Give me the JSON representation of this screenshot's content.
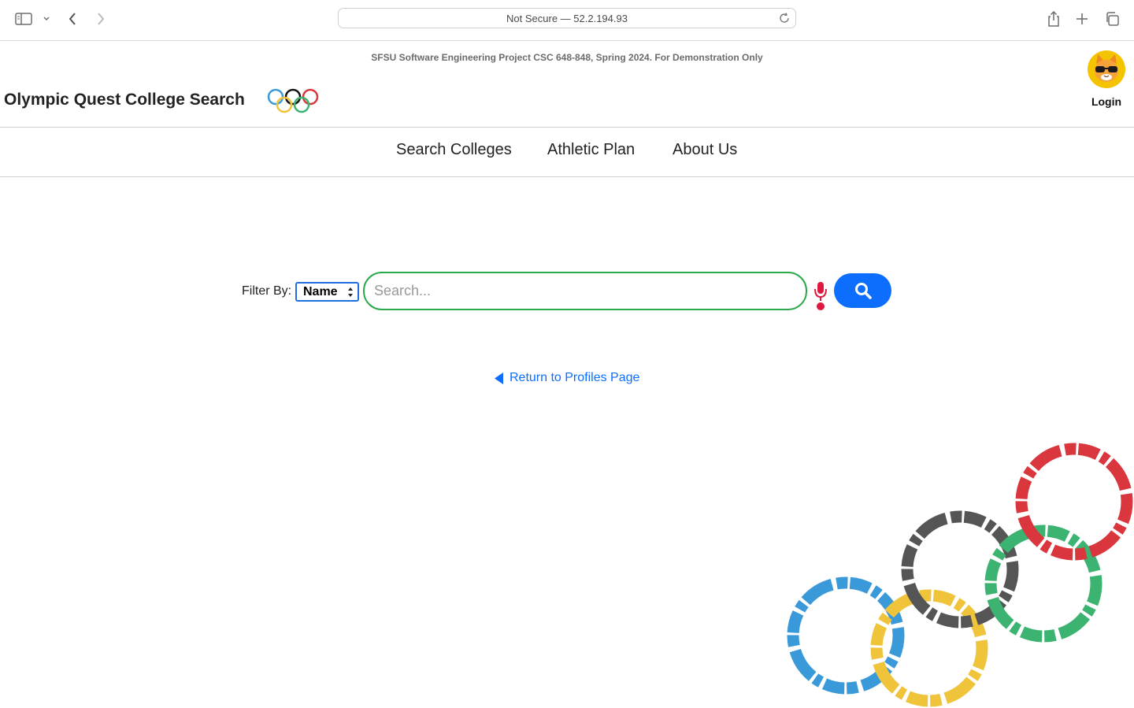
{
  "browser": {
    "url": "Not Secure — 52.2.194.93",
    "icons": [
      "sidebar-icon",
      "chevron-down-icon",
      "back-icon",
      "forward-icon",
      "reload-icon",
      "share-icon",
      "new-tab-icon",
      "tabs-overview-icon"
    ]
  },
  "header": {
    "disclaimer": "SFSU Software Engineering Project CSC 648-848, Spring 2024. For Demonstration Only",
    "title": "Olympic Quest College Search",
    "login_label": "Login"
  },
  "nav": {
    "items": [
      {
        "label": "Search Colleges"
      },
      {
        "label": "Athletic Plan"
      },
      {
        "label": "About Us"
      }
    ]
  },
  "search": {
    "filter_label": "Filter By:",
    "filter_value": "Name",
    "placeholder": "Search...",
    "value": ""
  },
  "return_link": "Return to Profiles Page",
  "colors": {
    "accent": "#0d6efd",
    "input_border": "#2ba84a",
    "mic": "#e0173e",
    "ring_blue": "#3a9ad9",
    "ring_yellow": "#f0c43a",
    "ring_black": "#555555",
    "ring_green": "#3cb371",
    "ring_red": "#d9363e"
  }
}
